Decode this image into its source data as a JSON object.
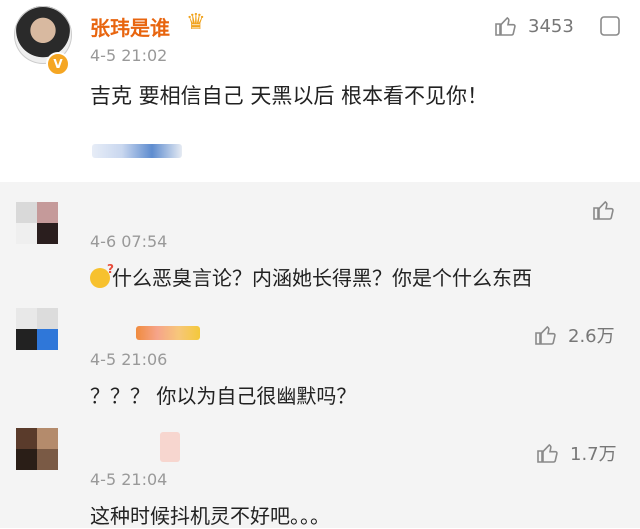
{
  "main_comment": {
    "username": "张玮是谁",
    "time": "4-5 21:02",
    "text": "吉克 要相信自己 天黑以后 根本看不见你！",
    "likes": "3453"
  },
  "replies": [
    {
      "time": "4-6 07:54",
      "text": "什么恶臭言论？内涵她长得黑？你是个什么东西",
      "likes": ""
    },
    {
      "time": "4-5 21:06",
      "text": "？？？ 你以为自己很幽默吗？",
      "likes": "2.6万"
    },
    {
      "time": "4-5 21:04",
      "text": "这种时候抖机灵不好吧。。。",
      "likes": "1.7万"
    }
  ],
  "icons": {
    "like": "thumbs-up-icon",
    "verified": "verified-badge-icon",
    "vip": "crown-icon"
  },
  "colors": {
    "username": "#e8650f",
    "reply_bg": "#f4f4f4",
    "muted": "#999999"
  }
}
